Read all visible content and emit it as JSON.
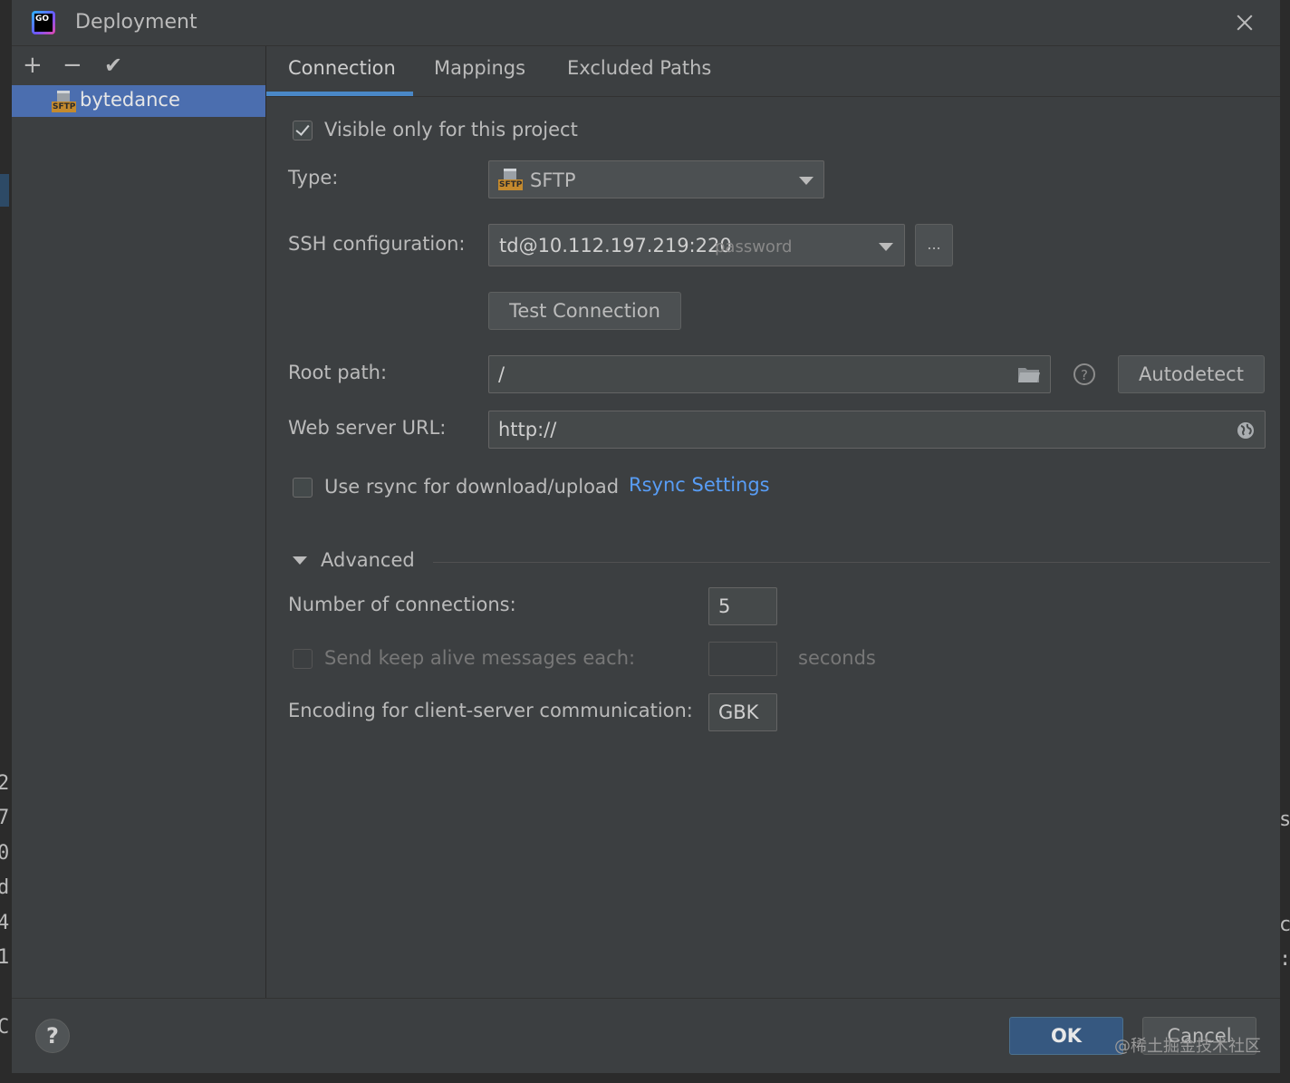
{
  "window": {
    "title": "Deployment"
  },
  "left_toolbar": {
    "add": "+",
    "remove": "−",
    "apply": "✔"
  },
  "servers": [
    {
      "name": "bytedance",
      "type_badge": "SFTP"
    }
  ],
  "tabs": [
    {
      "label": "Connection",
      "active": true
    },
    {
      "label": "Mappings",
      "active": false
    },
    {
      "label": "Excluded Paths",
      "active": false
    }
  ],
  "connection": {
    "visible_only": {
      "label": "Visible only for this project",
      "checked": true
    },
    "type": {
      "label": "Type:",
      "value": "SFTP",
      "badge": "SFTP"
    },
    "ssh": {
      "label": "SSH configuration:",
      "value": "td@10.112.197.219:220",
      "hint": "password",
      "more_button": "..."
    },
    "test_button": "Test Connection",
    "root_path": {
      "label": "Root path:",
      "value": "/"
    },
    "autodetect_button": "Autodetect",
    "web_url": {
      "label": "Web server URL:",
      "value": "http://"
    },
    "rsync": {
      "label": "Use rsync for download/upload",
      "checked": false,
      "link": "Rsync Settings"
    }
  },
  "advanced": {
    "title": "Advanced",
    "connections": {
      "label": "Number of connections:",
      "value": "5"
    },
    "keep_alive": {
      "label": "Send keep alive messages each:",
      "value": "",
      "unit": "seconds",
      "checked": false,
      "enabled": false
    },
    "encoding": {
      "label": "Encoding for client-server communication:",
      "value": "GBK"
    }
  },
  "footer": {
    "help": "?",
    "ok": "OK",
    "cancel": "Cancel"
  },
  "watermark": "@稀土掘金技术社区",
  "background_chars": {
    "left": [
      "2",
      "7",
      "0",
      "d",
      "4",
      "1",
      "C"
    ],
    "right": [
      "s",
      "c",
      ":"
    ]
  },
  "colors": {
    "dialog_bg": "#3c3f41",
    "selection": "#4b6eaf",
    "accent": "#4a88c7",
    "link": "#589df6",
    "ok_button": "#365880"
  }
}
